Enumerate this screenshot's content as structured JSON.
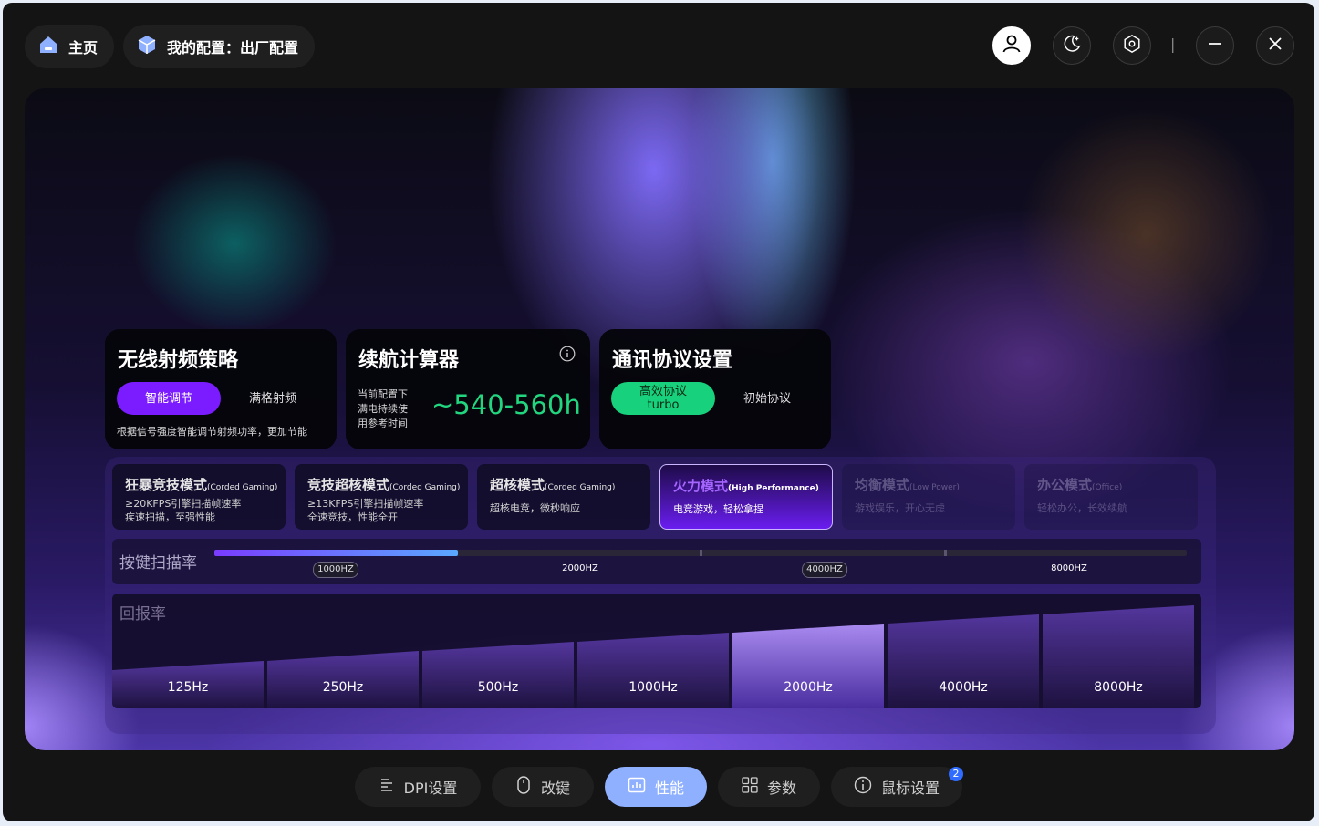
{
  "header": {
    "home_label": "主页",
    "config_label": "我的配置：出厂配置",
    "window_controls": [
      "user-icon",
      "moon-icon",
      "settings-icon",
      "minimize-icon",
      "close-icon"
    ],
    "separator": "|"
  },
  "rf_card": {
    "title": "无线射频策略",
    "options": [
      "智能调节",
      "满格射频"
    ],
    "selected": "智能调节",
    "description": "根据信号强度智能调节射频功率，更加节能"
  },
  "battery_card": {
    "title": "续航计算器",
    "info_icon": "info-icon",
    "caption_line1": "当前配置下",
    "caption_line2": "满电持续使",
    "caption_line3": "用参考时间",
    "value": "~540-560h"
  },
  "protocol_card": {
    "title": "通讯协议设置",
    "primary_line1": "高效协议",
    "primary_line2": "turbo",
    "secondary": "初始协议"
  },
  "modes": [
    {
      "name": "狂暴竞技模式",
      "tag": "(Corded Gaming)",
      "line1": "≥20KFPS引擎扫描帧速率",
      "line2": "疾速扫描，至强性能"
    },
    {
      "name": "竞技超核模式",
      "tag": "(Corded Gaming)",
      "line1": "≥13KFPS引擎扫描帧速率",
      "line2": "全速竞技，性能全开"
    },
    {
      "name": "超核模式",
      "tag": "(Corded Gaming)",
      "line1": "超核电竞，微秒响应",
      "line2": ""
    },
    {
      "name": "火力模式",
      "tag": "(High Performance)",
      "line1": "电竞游戏，轻松拿捏",
      "line2": ""
    },
    {
      "name": "均衡模式",
      "tag": "(Low Power)",
      "line1": "游戏娱乐，开心无虑",
      "line2": ""
    },
    {
      "name": "办公模式",
      "tag": "(Office)",
      "line1": "轻松办公，长效续航",
      "line2": ""
    }
  ],
  "active_mode": "火力模式",
  "scan_rate": {
    "label": "按键扫描率",
    "stops": [
      "1000HZ",
      "2000HZ",
      "4000HZ",
      "8000HZ"
    ],
    "selected": "1000HZ",
    "level": 0.25
  },
  "report_rate": {
    "label": "回报率",
    "options": [
      "125Hz",
      "250Hz",
      "500Hz",
      "1000Hz",
      "2000Hz",
      "4000Hz",
      "8000Hz"
    ],
    "selected": "2000Hz"
  },
  "nav": {
    "tabs": [
      {
        "label": "DPI设置",
        "icon": "dpi-icon"
      },
      {
        "label": "改键",
        "icon": "mouse-icon"
      },
      {
        "label": "性能",
        "icon": "performance-icon"
      },
      {
        "label": "参数",
        "icon": "grid-icon"
      },
      {
        "label": "鼠标设置",
        "icon": "info-icon"
      }
    ],
    "active": "性能",
    "badge": "2"
  },
  "colors": {
    "accent_purple": "#7a1cff",
    "accent_green": "#17d17c",
    "active_tab": "#8fb0ff",
    "window_bg": "#141414"
  }
}
